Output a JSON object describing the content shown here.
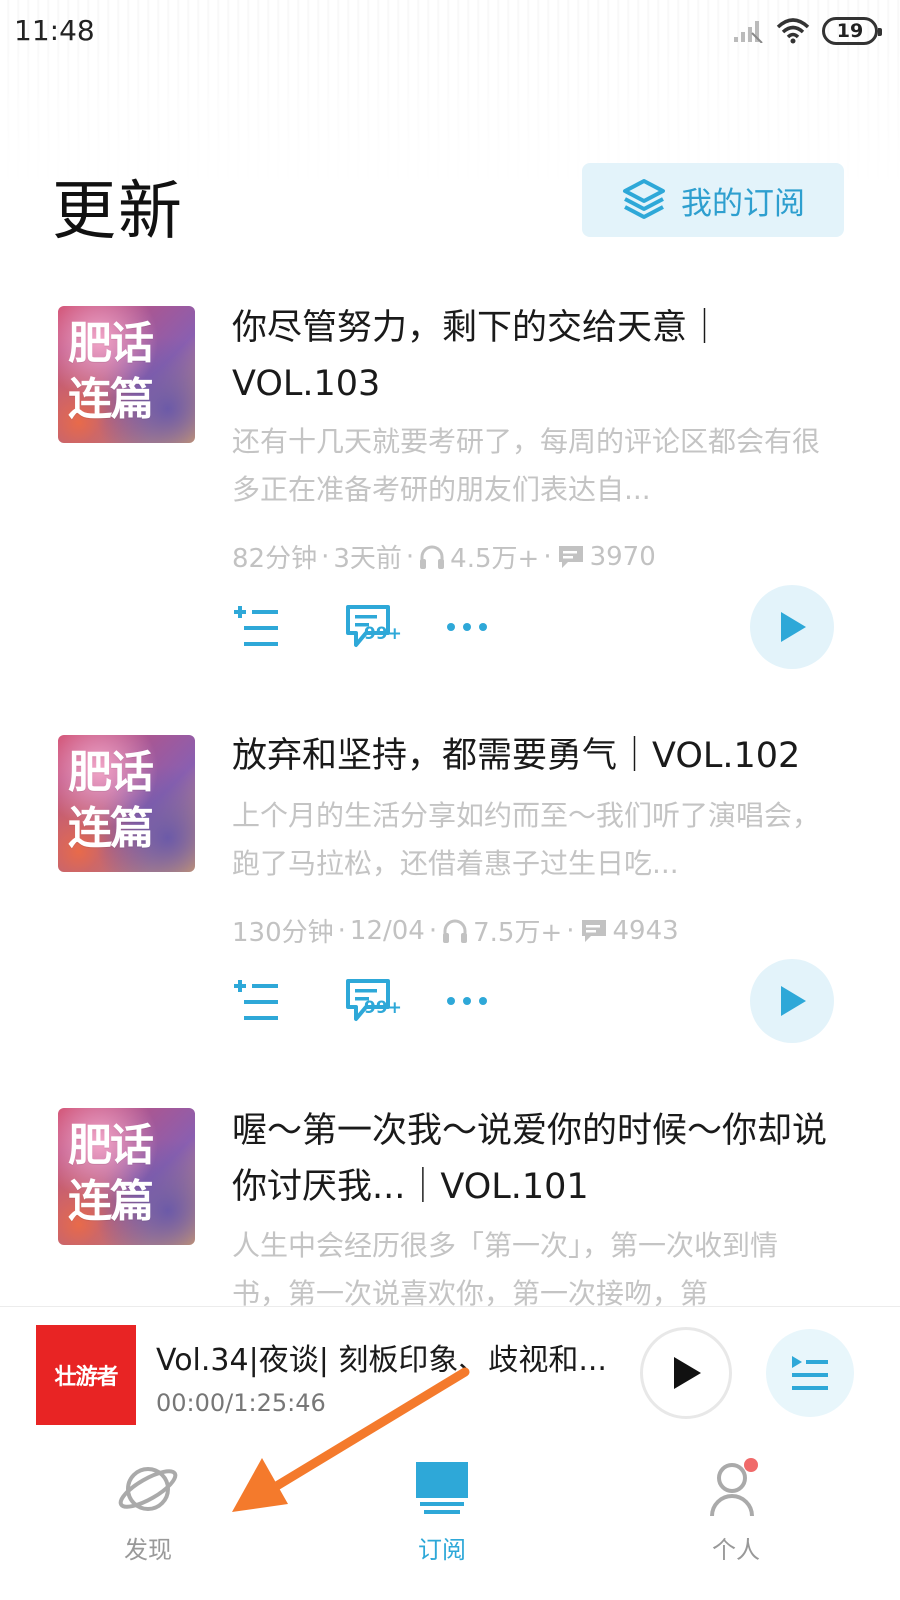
{
  "status_bar": {
    "time": "11:48",
    "battery": "19"
  },
  "header": {
    "title": "更新",
    "subscribe_button": "我的订阅"
  },
  "episodes": [
    {
      "cover_text": "肥话连篇",
      "title": "你尽管努力，剩下的交给天意｜VOL.103",
      "description": "还有十几天就要考研了，每周的评论区都会有很多正在准备考研的朋友们表达自...",
      "duration": "82分钟",
      "date": "3天前",
      "plays": "4.5万+",
      "comments": "3970",
      "comment_badge": "99+"
    },
    {
      "cover_text": "肥话连篇",
      "title": "放弃和坚持，都需要勇气｜VOL.102",
      "description": "上个月的生活分享如约而至～我们听了演唱会，跑了马拉松，还借着惠子过生日吃...",
      "duration": "130分钟",
      "date": "12/04",
      "plays": "7.5万+",
      "comments": "4943",
      "comment_badge": "99+"
    },
    {
      "cover_text": "肥话连篇",
      "title": "喔～第一次我～说爱你的时候～你却说你讨厌我...｜VOL.101",
      "description": "人生中会经历很多「第一次」，第一次收到情书，第一次说喜欢你，第一次接吻，第"
    }
  ],
  "mini_player": {
    "cover_text": "壮游者",
    "title": "Vol.34|夜谈| 刻板印象、歧视和...",
    "time": "00:00/1:25:46"
  },
  "tabs": [
    {
      "label": "发现"
    },
    {
      "label": "订阅"
    },
    {
      "label": "个人"
    }
  ],
  "colors": {
    "accent": "#2ea8d8",
    "annotation_arrow": "#f47a2c"
  }
}
